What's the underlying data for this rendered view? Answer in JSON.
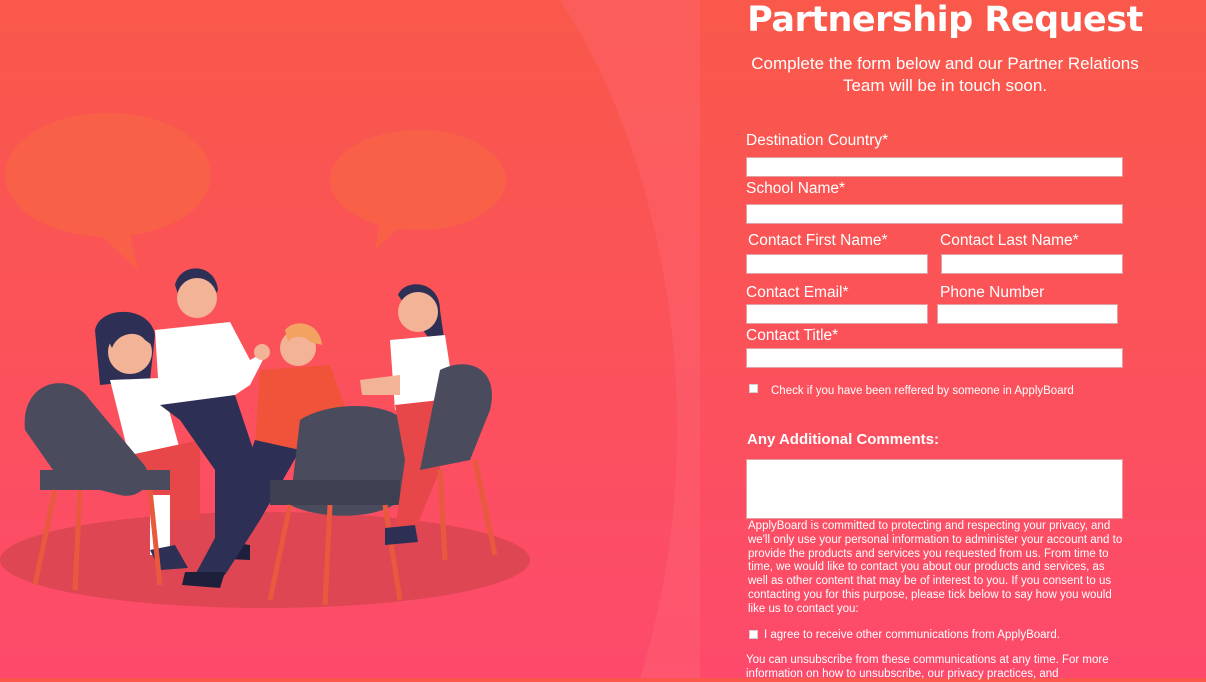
{
  "header": {
    "title": "Partnership Request",
    "subtitle": "Complete the form below and our Partner Relations Team will be in touch soon."
  },
  "form": {
    "destination_country": {
      "label": "Destination Country*",
      "value": ""
    },
    "school_name": {
      "label": "School Name*",
      "value": ""
    },
    "contact_first_name": {
      "label": "Contact First Name*",
      "value": ""
    },
    "contact_last_name": {
      "label": "Contact Last Name*",
      "value": ""
    },
    "contact_email": {
      "label": "Contact Email*",
      "value": ""
    },
    "phone_number": {
      "label": "Phone Number",
      "value": ""
    },
    "contact_title": {
      "label": "Contact Title*",
      "value": ""
    },
    "referral_checkbox": {
      "label": "Check if you have been reffered by someone in ApplyBoard",
      "checked": false
    },
    "comments": {
      "label": "Any Additional Comments:",
      "value": ""
    },
    "privacy_text": "ApplyBoard is committed to protecting and respecting your privacy, and we'll only use your personal information to administer your account and to provide the products and services you requested from us. From time to time, we would like to contact you about our products and services, as well as other content that may be of interest to you. If you consent to us contacting you for this purpose, please tick below to say how you would like us to contact you:",
    "consent_checkbox": {
      "label": "I agree to receive other communications from ApplyBoard.",
      "checked": false
    },
    "unsubscribe_text": "You can unsubscribe from these communications at any time. For more information on how to unsubscribe, our privacy practices, and"
  },
  "colors": {
    "background_top": "#f9584a",
    "background_bottom": "#fd4a6c",
    "chair": "#4a4c5e",
    "shirt_red": "#f0523a"
  },
  "illustration": {
    "icons": [
      "speech-bubble-icon",
      "speech-bubble-icon"
    ]
  }
}
